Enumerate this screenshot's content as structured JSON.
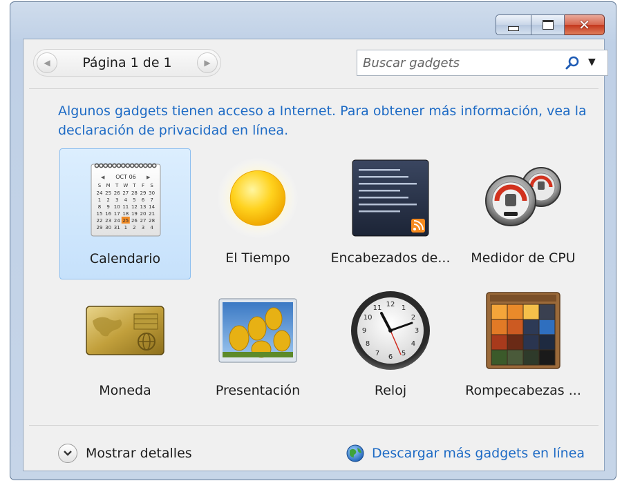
{
  "nav": {
    "page_label": "Página 1 de 1",
    "prev_glyph": "◀",
    "next_glyph": "▶"
  },
  "search": {
    "placeholder": "Buscar gadgets",
    "value": "",
    "icon": "search-icon",
    "dropdown_glyph": "▼"
  },
  "window_controls": {
    "close_glyph": "✕"
  },
  "privacy_notice": "Algunos gadgets tienen acceso a Internet. Para obtener más información, vea la declaración de privacidad en línea.",
  "calendar_thumb": {
    "month": "OCT 06",
    "weekdays": [
      "S",
      "M",
      "T",
      "W",
      "T",
      "F",
      "S"
    ],
    "days": [
      "24",
      "25",
      "26",
      "27",
      "28",
      "29",
      "30",
      "1",
      "2",
      "3",
      "4",
      "5",
      "6",
      "7",
      "8",
      "9",
      "10",
      "11",
      "12",
      "13",
      "14",
      "15",
      "16",
      "17",
      "18",
      "19",
      "20",
      "21",
      "22",
      "23",
      "24",
      "25",
      "26",
      "27",
      "28",
      "29",
      "30",
      "31",
      "1",
      "2",
      "3",
      "4"
    ],
    "highlight_day": "25"
  },
  "gadgets": [
    {
      "label": "Calendario",
      "icon": "calendar-icon",
      "selected": true
    },
    {
      "label": "El Tiempo",
      "icon": "sun-icon",
      "selected": false
    },
    {
      "label": "Encabezados de...",
      "icon": "rss-headlines-icon",
      "selected": false
    },
    {
      "label": "Medidor de CPU",
      "icon": "cpu-gauge-icon",
      "selected": false
    },
    {
      "label": "Moneda",
      "icon": "currency-card-icon",
      "selected": false
    },
    {
      "label": "Presentación",
      "icon": "slideshow-photo-icon",
      "selected": false
    },
    {
      "label": "Reloj",
      "icon": "clock-icon",
      "selected": false
    },
    {
      "label": "Rompecabezas ...",
      "icon": "puzzle-icon",
      "selected": false
    }
  ],
  "footer": {
    "show_details": "Mostrar detalles",
    "get_more": "Descargar más gadgets en línea"
  },
  "colors": {
    "link": "#1e6bc5",
    "selection": "#c6e1fb",
    "close_button": "#c3361c"
  }
}
